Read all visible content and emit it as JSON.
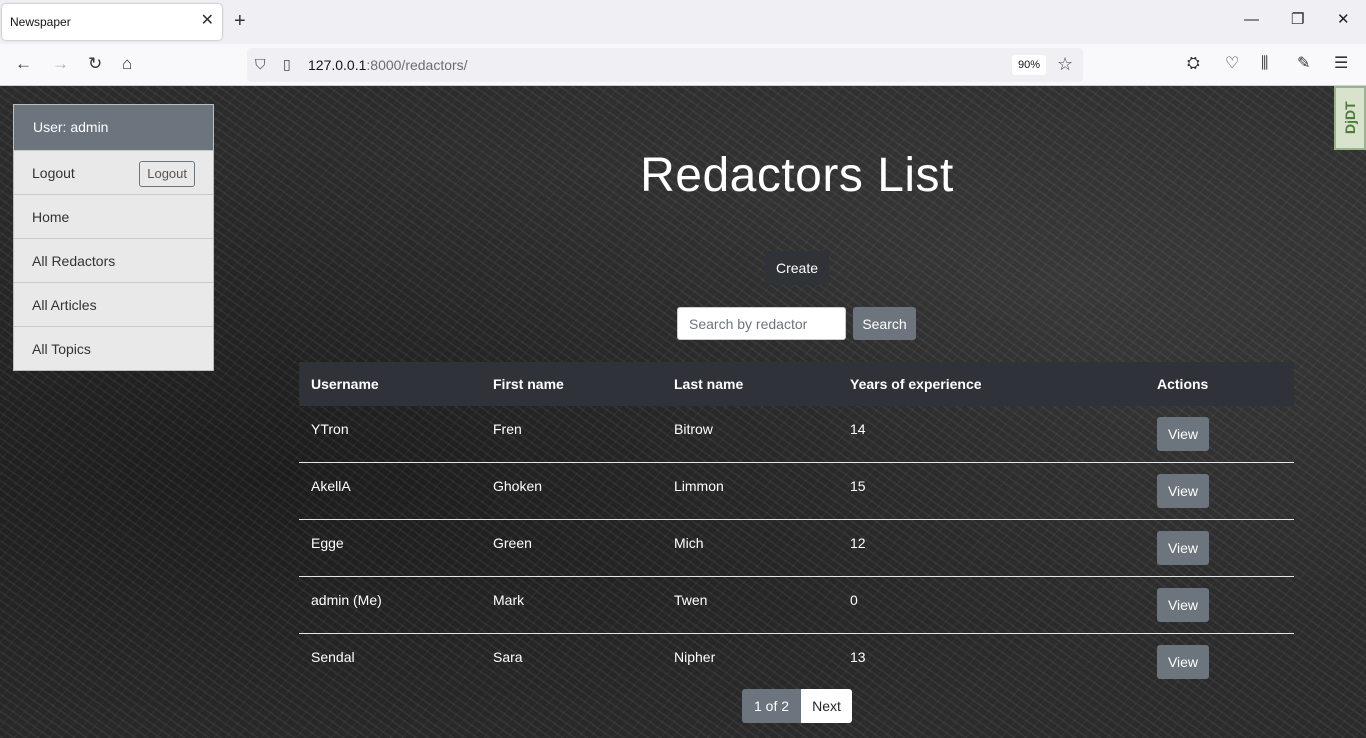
{
  "browser": {
    "tab_title": "Newspaper",
    "url_host": "127.0.0.1",
    "url_rest": ":8000/redactors/",
    "zoom": "90%"
  },
  "sidebar": {
    "user_label": "User: admin",
    "logout_label": "Logout",
    "logout_button": "Logout",
    "items": [
      {
        "label": "Home"
      },
      {
        "label": "All Redactors"
      },
      {
        "label": "All Articles"
      },
      {
        "label": "All Topics"
      }
    ]
  },
  "djdt": "DjDT",
  "main": {
    "title": "Redactors List",
    "create_label": "Create",
    "search_placeholder": "Search by redactor",
    "search_label": "Search"
  },
  "table": {
    "headers": [
      "Username",
      "First name",
      "Last name",
      "Years of experience",
      "Actions"
    ],
    "rows": [
      {
        "username": "YTron",
        "first_name": "Fren",
        "last_name": "Bitrow",
        "years": "14",
        "action": "View"
      },
      {
        "username": "AkellA",
        "first_name": "Ghoken",
        "last_name": "Limmon",
        "years": "15",
        "action": "View"
      },
      {
        "username": "Egge",
        "first_name": "Green",
        "last_name": "Mich",
        "years": "12",
        "action": "View"
      },
      {
        "username": "admin (Me)",
        "first_name": "Mark",
        "last_name": "Twen",
        "years": "0",
        "action": "View"
      },
      {
        "username": "Sendal",
        "first_name": "Sara",
        "last_name": "Nipher",
        "years": "13",
        "action": "View"
      }
    ]
  },
  "pagination": {
    "current": "1 of 2",
    "next": "Next"
  },
  "colors": {
    "table_header": "#2f3339",
    "secondary": "#6c757d"
  }
}
